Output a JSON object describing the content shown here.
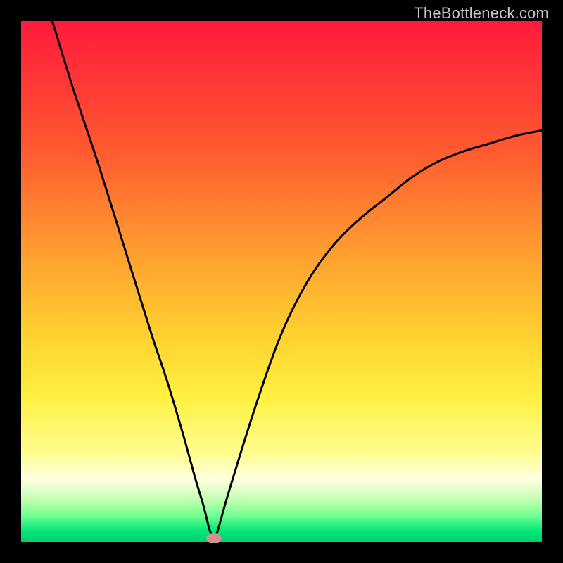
{
  "watermark": "TheBottleneck.com",
  "colors": {
    "marker": "#d49090",
    "curve": "#000000"
  },
  "chart_data": {
    "type": "line",
    "title": "",
    "xlabel": "",
    "ylabel": "",
    "xlim": [
      0,
      100
    ],
    "ylim": [
      0,
      100
    ],
    "grid": false,
    "legend": false,
    "annotations": [],
    "series": [
      {
        "name": "bottleneck-curve",
        "x": [
          6,
          10,
          15,
          20,
          25,
          28,
          31,
          33.5,
          35,
          36,
          36.5,
          37,
          37.5,
          38,
          40,
          45,
          50,
          55,
          60,
          65,
          70,
          75,
          80,
          85,
          90,
          95,
          100
        ],
        "y": [
          100,
          87,
          72,
          56,
          40,
          31,
          21,
          12,
          7,
          3,
          1.5,
          0.7,
          1.5,
          3,
          10,
          26,
          40,
          50,
          57,
          62,
          66,
          70,
          73,
          75,
          76.5,
          78,
          79
        ]
      }
    ],
    "marker": {
      "x": 37,
      "y": 0.7,
      "label": "optimal-point"
    }
  }
}
